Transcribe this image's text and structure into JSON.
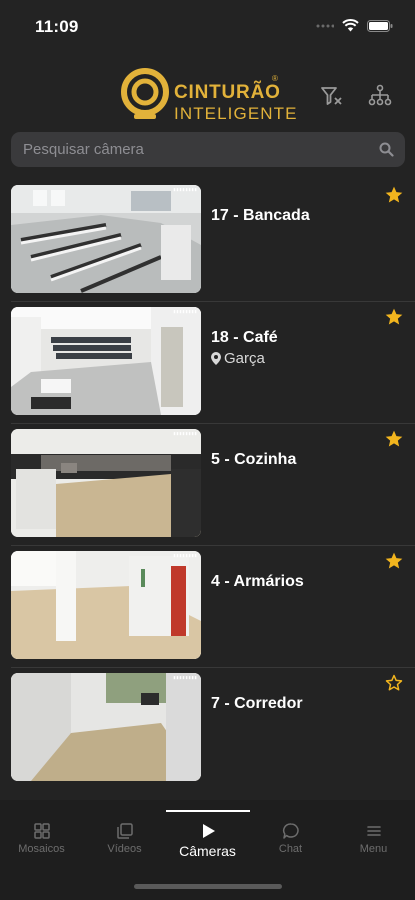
{
  "status_bar": {
    "time": "11:09"
  },
  "header": {
    "logo_line1": "CINTURÃO",
    "logo_line2": "INTELIGENTE",
    "filter_clear_icon": "filter-clear-icon",
    "hierarchy_icon": "hierarchy-icon"
  },
  "search": {
    "placeholder": "Pesquisar câmera"
  },
  "cameras": [
    {
      "name": "17 - Bancada",
      "location": "",
      "favorite": true
    },
    {
      "name": "18 - Café",
      "location": "Garça",
      "favorite": true
    },
    {
      "name": "5 - Cozinha",
      "location": "",
      "favorite": true
    },
    {
      "name": "4 - Armários",
      "location": "",
      "favorite": true
    },
    {
      "name": "7 - Corredor",
      "location": "",
      "favorite": false
    }
  ],
  "tabs": [
    {
      "label": "Mosaicos",
      "icon": "grid-icon",
      "active": false
    },
    {
      "label": "Vídeos",
      "icon": "videos-icon",
      "active": false
    },
    {
      "label": "Câmeras",
      "icon": "play-icon",
      "active": true
    },
    {
      "label": "Chat",
      "icon": "chat-icon",
      "active": false
    },
    {
      "label": "Menu",
      "icon": "menu-icon",
      "active": false
    }
  ],
  "colors": {
    "accent": "#e2b23a",
    "background": "#232323",
    "star": "#f2b51e"
  }
}
